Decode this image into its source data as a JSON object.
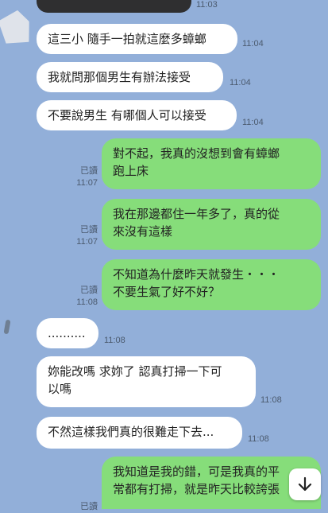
{
  "chat": {
    "top_time": "11:03",
    "messages": [
      {
        "dir": "in",
        "text": "這三小 隨手一拍就這麼多蟑螂",
        "time": "11:04"
      },
      {
        "dir": "in",
        "text": "我就問那個男生有辦法接受",
        "time": "11:04"
      },
      {
        "dir": "in",
        "text": "不要說男生 有哪個人可以接受",
        "time": "11:04"
      },
      {
        "dir": "out",
        "text": "對不起，我真的沒想到會有蟑螂\n跑上床",
        "read": "已讀",
        "time": "11:07"
      },
      {
        "dir": "out",
        "text": "我在那邊都住一年多了，真的從\n來沒有這樣",
        "read": "已讀",
        "time": "11:07"
      },
      {
        "dir": "out",
        "text": "不知道為什麼昨天就發生・・・\n不要生氣了好不好？",
        "read": "已讀",
        "time": "11:08"
      },
      {
        "dir": "in",
        "text": "..........",
        "time": "11:08"
      },
      {
        "dir": "in",
        "text": "妳能改嗎 求妳了 認真打掃一下可\n以嗎",
        "time": "11:08"
      },
      {
        "dir": "in",
        "text": "不然這樣我們真的很難走下去...",
        "time": "11:08"
      },
      {
        "dir": "out",
        "text": "我知道是我的錯，可是我真的平\n常都有打掃，就是昨天比較誇張",
        "read": "已讀",
        "time": ""
      }
    ]
  },
  "scroll_button": {
    "icon": "arrow-down-icon"
  }
}
